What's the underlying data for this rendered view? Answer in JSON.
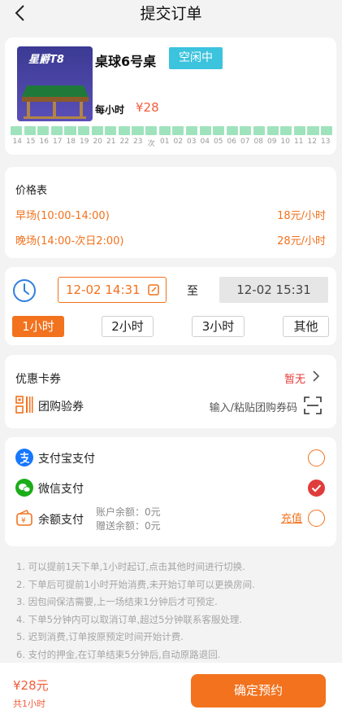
{
  "header": {
    "title": "提交订单"
  },
  "table": {
    "name": "桌球6号桌",
    "status": "空闲中",
    "rate_label": "每小时",
    "rate_price": "¥28",
    "logo_text": "星爵T8",
    "slot_labels": [
      "14",
      "15",
      "16",
      "17",
      "18",
      "19",
      "20",
      "21",
      "22",
      "23",
      "次",
      "01",
      "02",
      "03",
      "04",
      "05",
      "06",
      "07",
      "08",
      "09",
      "10",
      "11",
      "12",
      "13"
    ]
  },
  "price_table": {
    "title": "价格表",
    "rows": [
      {
        "label": "早场(10:00-14:00)",
        "price": "18元/小时"
      },
      {
        "label": "晚场(14:00-次日2:00)",
        "price": "28元/小时"
      }
    ]
  },
  "time": {
    "start": "12-02 14:31",
    "to": "至",
    "end": "12-02 15:31",
    "durations": [
      {
        "label": "1小时",
        "active": true
      },
      {
        "label": "2小时",
        "active": false
      },
      {
        "label": "3小时",
        "active": false
      },
      {
        "label": "其他",
        "active": false
      }
    ]
  },
  "coupons": {
    "label": "优惠卡券",
    "value": "暂无",
    "groupbuy_label": "团购验券",
    "groupbuy_placeholder": "输入/粘贴团购券码"
  },
  "payment": {
    "alipay": "支付宝支付",
    "wechat": "微信支付",
    "balance": "余额支付",
    "account_balance": "账户余额：0元",
    "gift_balance": "赠送余额：0元",
    "recharge": "充值",
    "selected": "wechat",
    "colors": {
      "alipay": "#1677ff",
      "wechat": "#1aad19",
      "accent": "#f2721d"
    }
  },
  "notes": [
    "1. 可以提前1天下单,1小时起订,点击其他时间进行切换.",
    "2. 下单后可提前1小时开始消费,未开始订单可以更换房间.",
    "3. 因包间保洁需要,上一场结束1分钟后才可预定.",
    "4. 下单5分钟内可以取消订单,超过5分钟联系客服处理.",
    "5. 迟到消费,订单按原预定时间开始计费.",
    "6. 支付的押金,在订单结束5分钟后,自动原路退回."
  ],
  "footer": {
    "total": "¥28元",
    "total_sub": "共1小时",
    "confirm": "确定预约"
  }
}
